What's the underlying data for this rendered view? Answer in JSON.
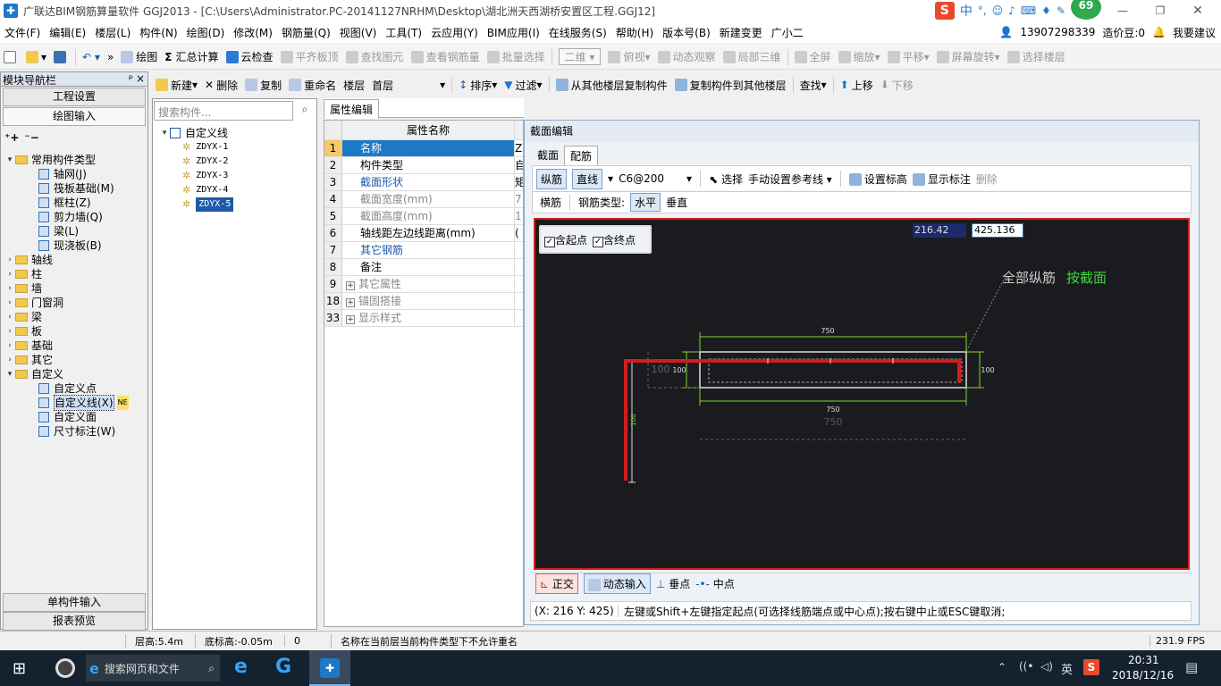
{
  "titlebar": {
    "title": "广联达BIM钢筋算量软件 GGJ2013 - [C:\\Users\\Administrator.PC-20141127NRHM\\Desktop\\湖北洲天西湖桥安置区工程.GGJ12]",
    "ime": "中",
    "badge": "69"
  },
  "menu": {
    "items": [
      "文件(F)",
      "编辑(E)",
      "楼层(L)",
      "构件(N)",
      "绘图(D)",
      "修改(M)",
      "钢筋量(Q)",
      "视图(V)",
      "工具(T)",
      "云应用(Y)",
      "BIM应用(I)",
      "在线服务(S)",
      "帮助(H)",
      "版本号(B)",
      "新建变更",
      "广小二"
    ],
    "phone": "13907298339",
    "cost_bean": "造价豆:0",
    "suggest": "我要建议"
  },
  "toolbar1": {
    "draw": "绘图",
    "sum": "汇总计算",
    "cloud": "云检查",
    "align": "平齐板顶",
    "find": "查找图元",
    "view_rebar": "查看钢筋量",
    "batch": "批量选择",
    "view2d": "二维",
    "top": "俯视",
    "dynamic": "动态观察",
    "local3d": "局部三维",
    "full": "全屏",
    "zoom": "缩放",
    "pan": "平移",
    "rotate": "屏幕旋转",
    "select_floor": "选择楼层"
  },
  "toolbar2": {
    "new": "新建",
    "delete": "删除",
    "copy": "复制",
    "rename": "重命名",
    "floor_label": "楼层",
    "floor_value": "首层",
    "sort": "排序",
    "filter": "过滤",
    "copy_from": "从其他楼层复制构件",
    "copy_to": "复制构件到其他楼层",
    "search": "查找",
    "up": "上移",
    "down": "下移"
  },
  "nav": {
    "title": "模块导航栏",
    "project_settings": "工程设置",
    "draw_input": "绘图输入",
    "single_input": "单构件输入",
    "report_preview": "报表预览",
    "tree": [
      {
        "label": "常用构件类型",
        "level": 0,
        "toggle": "▾",
        "kind": "folder"
      },
      {
        "label": "轴网(J)",
        "level": 1,
        "kind": "comp"
      },
      {
        "label": "筏板基础(M)",
        "level": 1,
        "kind": "comp"
      },
      {
        "label": "框柱(Z)",
        "level": 1,
        "kind": "comp"
      },
      {
        "label": "剪力墙(Q)",
        "level": 1,
        "kind": "comp"
      },
      {
        "label": "梁(L)",
        "level": 1,
        "kind": "comp"
      },
      {
        "label": "现浇板(B)",
        "level": 1,
        "kind": "comp"
      },
      {
        "label": "轴线",
        "level": 0,
        "toggle": "›",
        "kind": "folder"
      },
      {
        "label": "柱",
        "level": 0,
        "toggle": "›",
        "kind": "folder"
      },
      {
        "label": "墙",
        "level": 0,
        "toggle": "›",
        "kind": "folder"
      },
      {
        "label": "门窗洞",
        "level": 0,
        "toggle": "›",
        "kind": "folder"
      },
      {
        "label": "梁",
        "level": 0,
        "toggle": "›",
        "kind": "folder"
      },
      {
        "label": "板",
        "level": 0,
        "toggle": "›",
        "kind": "folder"
      },
      {
        "label": "基础",
        "level": 0,
        "toggle": "›",
        "kind": "folder"
      },
      {
        "label": "其它",
        "level": 0,
        "toggle": "›",
        "kind": "folder"
      },
      {
        "label": "自定义",
        "level": 0,
        "toggle": "▾",
        "kind": "folder"
      },
      {
        "label": "自定义点",
        "level": 1,
        "kind": "comp"
      },
      {
        "label": "自定义线(X)",
        "level": 1,
        "kind": "comp",
        "selected": true,
        "tag": "NE"
      },
      {
        "label": "自定义面",
        "level": 1,
        "kind": "comp"
      },
      {
        "label": "尺寸标注(W)",
        "level": 1,
        "kind": "comp"
      }
    ]
  },
  "list": {
    "search_placeholder": "搜索构件...",
    "root": "自定义线",
    "items": [
      "ZDYX-1",
      "ZDYX-2",
      "ZDYX-3",
      "ZDYX-4",
      "ZDYX-5"
    ],
    "selected": "ZDYX-5"
  },
  "props": {
    "tab": "属性编辑",
    "header": "属性名称",
    "rows": [
      {
        "n": "1",
        "name": "名称",
        "val": "Z",
        "style": "selected"
      },
      {
        "n": "2",
        "name": "构件类型",
        "val": "自",
        "style": "normal"
      },
      {
        "n": "3",
        "name": "截面形状",
        "val": "矩",
        "style": "blue"
      },
      {
        "n": "4",
        "name": "截面宽度(mm)",
        "val": "7",
        "style": "gray"
      },
      {
        "n": "5",
        "name": "截面高度(mm)",
        "val": "1",
        "style": "gray"
      },
      {
        "n": "6",
        "name": "轴线距左边线距离(mm)",
        "val": "(",
        "style": "normal"
      },
      {
        "n": "7",
        "name": "其它钢筋",
        "val": "",
        "style": "blue"
      },
      {
        "n": "8",
        "name": "备注",
        "val": "",
        "style": "normal"
      },
      {
        "n": "9",
        "name": "其它属性",
        "val": "",
        "style": "gray",
        "expand": true
      },
      {
        "n": "18",
        "name": "锚固搭接",
        "val": "",
        "style": "gray",
        "expand": true
      },
      {
        "n": "33",
        "name": "显示样式",
        "val": "",
        "style": "gray",
        "expand": true
      }
    ]
  },
  "dialog": {
    "title": "截面编辑",
    "tab_section": "截面",
    "tab_rebar": "配筋",
    "longitudinal": "纵筋",
    "straight": "直线",
    "rebar_spec": "C6@200",
    "select": "选择",
    "set_ref": "手动设置参考线",
    "set_elev": "设置标高",
    "show_mark": "显示标注",
    "delete": "删除",
    "stirrup": "横筋",
    "rebar_type_label": "钢筋类型:",
    "horizontal": "水平",
    "vertical": "垂直",
    "incl_start": "含起点",
    "incl_end": "含终点",
    "input_x": "216.42",
    "input_y": "425.136",
    "all_long": "全部纵筋",
    "by_section": "按截面",
    "dim_750": "750",
    "dim_100": "100",
    "dim_100b": "100",
    "dim_750_ghost": "750",
    "dim_100_ghost": "100",
    "dim_vert": "100",
    "ortho": "正交",
    "dyn_input": "动态输入",
    "perp": "垂点",
    "mid": "中点",
    "coord": "(X: 216 Y: 425)",
    "hint": "左键或Shift+左键指定起点(可选择线筋端点或中心点);按右键中止或ESC键取消;"
  },
  "status": {
    "floor_h": "层高:5.4m",
    "bottom_elev": "底标高:-0.05m",
    "zero": "0",
    "msg": "名称在当前层当前构件类型下不允许重名",
    "fps": "231.9 FPS"
  },
  "taskbar": {
    "search": "搜索网页和文件",
    "lang": "英",
    "time": "20:31",
    "date": "2018/12/16"
  },
  "colors": {
    "canvas_bg": "#1b1b1f",
    "rebar_red": "#d21d1d",
    "dim_green": "#7fd62a",
    "accent_blue": "#1e78c8"
  }
}
